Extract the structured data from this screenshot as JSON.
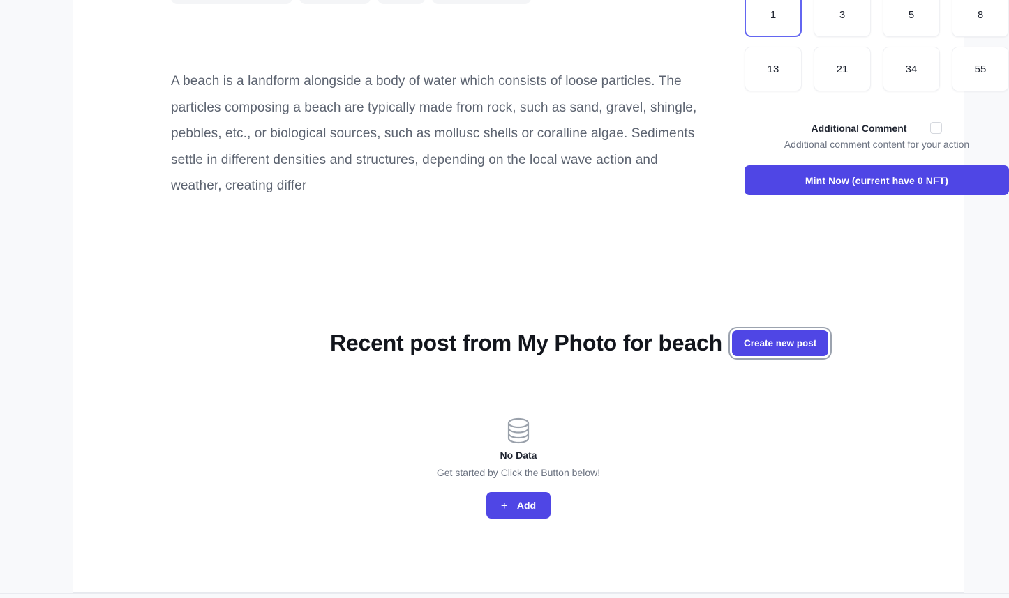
{
  "layout": {
    "accent_color": "#4f46e5",
    "selected_border_color": "#6366f1",
    "rail_color": "#f8f9fb",
    "page_background": "#ffffff"
  },
  "chips": [
    {
      "name": "chip-with-avatar",
      "label": ""
    },
    {
      "name": "chip-secondary",
      "label": ""
    },
    {
      "name": "chip-small",
      "label": ""
    },
    {
      "name": "chip-wide",
      "label": ""
    }
  ],
  "article": {
    "body": "A beach is a landform alongside a body of water which consists of loose particles. The particles composing a beach are typically made from rock, such as sand, gravel, shingle, pebbles, etc., or biological sources, such as mollusc shells or coralline algae. Sediments settle in different densities and structures, depending on the local wave action and weather, creating differ"
  },
  "quantity_picker": {
    "options": [
      {
        "value": "1",
        "selected": true
      },
      {
        "value": "3",
        "selected": false
      },
      {
        "value": "5",
        "selected": false
      },
      {
        "value": "8",
        "selected": false
      },
      {
        "value": "13",
        "selected": false
      },
      {
        "value": "21",
        "selected": false
      },
      {
        "value": "34",
        "selected": false
      },
      {
        "value": "55",
        "selected": false
      }
    ]
  },
  "additional_comment": {
    "label": "Additional Comment",
    "hint": "Additional comment content for your action",
    "checked": false
  },
  "mint": {
    "button_label": "Mint Now (current have 0 NFT)",
    "current_nft_count": "0"
  },
  "recent_post": {
    "title": "Recent post from My Photo for beach",
    "create_button_label": "Create new post"
  },
  "empty_state": {
    "icon": "database-icon",
    "title": "No Data",
    "subtitle": "Get started by Click the Button below!",
    "add_button_label": "Add",
    "add_button_plus": "+"
  }
}
